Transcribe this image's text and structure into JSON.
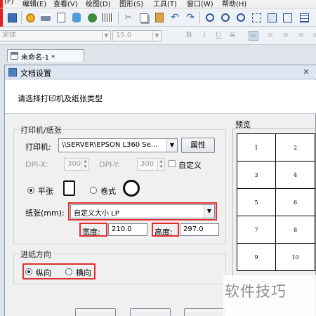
{
  "menu": {
    "items": [
      "(F)",
      "编辑(E)",
      "查看(V)",
      "绘图(D)",
      "图形(S)",
      "工具(T)",
      "窗口(W)",
      "帮助(H)"
    ]
  },
  "format_bar": {
    "font_name": "宋体",
    "font_size": "15.0",
    "bold": "B",
    "italic": "I",
    "underline": "U",
    "strike": "S"
  },
  "document_tab": {
    "title": "未命名-1 *"
  },
  "dialog": {
    "title": "文档设置",
    "close": "✕",
    "prompt": "请选择打印机及纸张类型",
    "printer_group": {
      "title": "打印机/纸张",
      "printer_label": "打印机:",
      "printer_value": "\\\\SERVER\\EPSON L360 Se...",
      "properties_button": "属性",
      "dpi_x_label": "DPI-X:",
      "dpi_x_value": "300",
      "dpi_y_label": "DPI-Y:",
      "dpi_y_value": "300",
      "custom_dpi_label": "自定义",
      "sheet_label": "平张",
      "sheet_selected": true,
      "roll_label": "卷式",
      "roll_selected": false,
      "paper_label": "纸张(mm):",
      "paper_value": "自定义大小 LP",
      "width_label": "宽度:",
      "width_value": "210.0",
      "height_label": "高度:",
      "height_value": "297.0"
    },
    "feed_group": {
      "title": "进纸方向",
      "portrait_label": "纵向",
      "portrait_selected": true,
      "landscape_label": "横向",
      "landscape_selected": false
    },
    "preview": {
      "title": "预览",
      "labels": [
        "1",
        "2",
        "3",
        "4",
        "5",
        "6",
        "7",
        "8",
        "9",
        "10"
      ]
    }
  },
  "watermark": {
    "text": "软件技巧"
  },
  "colors": {
    "highlight": "#e03030",
    "titlebar": "#dde6f1"
  }
}
